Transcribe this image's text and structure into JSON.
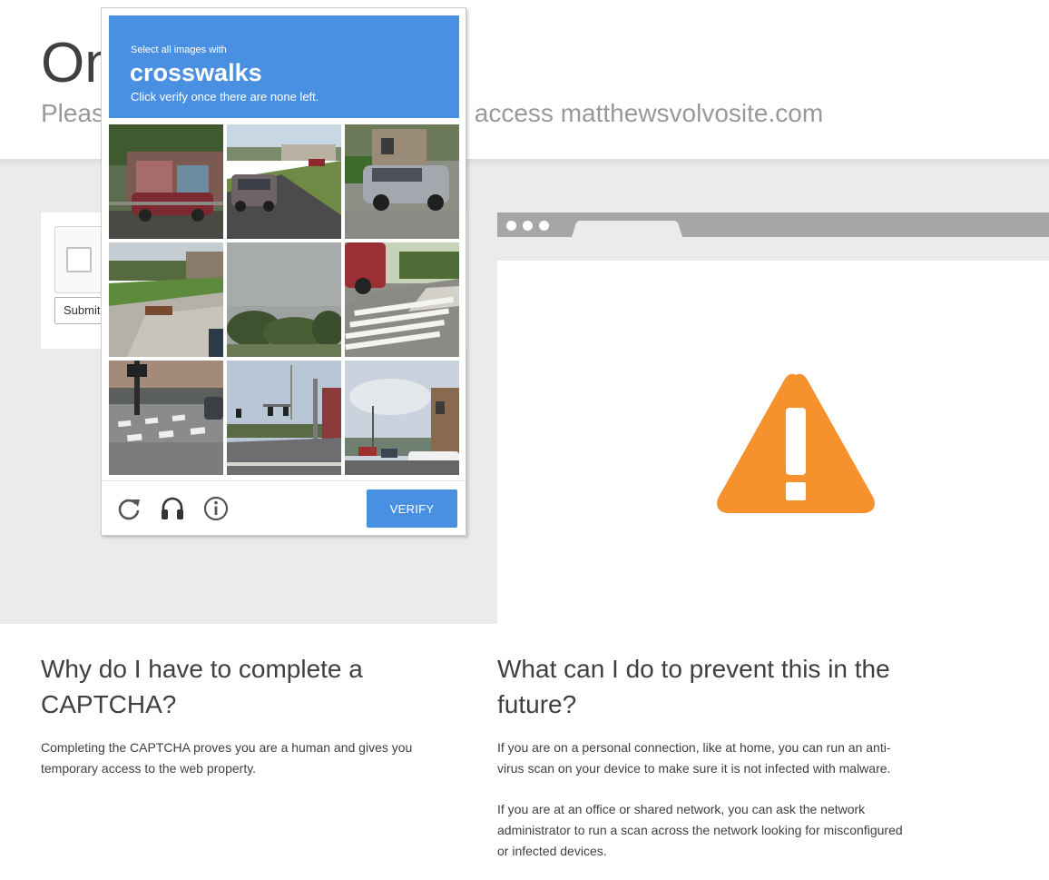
{
  "header": {
    "title": "One more step",
    "subtitle": "Please complete the security check to access matthewsvolvosite.com"
  },
  "widget": {
    "submit_label": "Submit"
  },
  "challenge": {
    "prompt_small": "Select all images with",
    "prompt_target": "crosswalks",
    "prompt_hint": "Click verify once there are none left.",
    "verify_label": "VERIFY",
    "tiles": [
      {
        "scene": "building with mural and car"
      },
      {
        "scene": "road with minivan and grass"
      },
      {
        "scene": "silver SUV by house"
      },
      {
        "scene": "sidewalk and park"
      },
      {
        "scene": "trees under overcast sky"
      },
      {
        "scene": "crosswalk with red SUV"
      },
      {
        "scene": "crosswalk by fence"
      },
      {
        "scene": "street with traffic lights"
      },
      {
        "scene": "residential street with cars"
      }
    ],
    "icons": [
      "reload-icon",
      "audio-icon",
      "info-icon"
    ]
  },
  "why": {
    "heading": "Why do I have to complete a CAPTCHA?",
    "body": "Completing the CAPTCHA proves you are a human and gives you temporary access to the web property."
  },
  "prevent": {
    "heading": "What can I do to prevent this in the future?",
    "body1": "If you are on a personal connection, like at home, you can run an anti-virus scan on your device to make sure it is not infected with malware.",
    "body2": "If you are at an office or shared network, you can ask the network administrator to run a scan across the network looking for misconfigured or infected devices."
  },
  "colors": {
    "accent_blue": "#4a90e2",
    "warning_orange": "#f6922d",
    "band_gray": "#ebebeb"
  }
}
